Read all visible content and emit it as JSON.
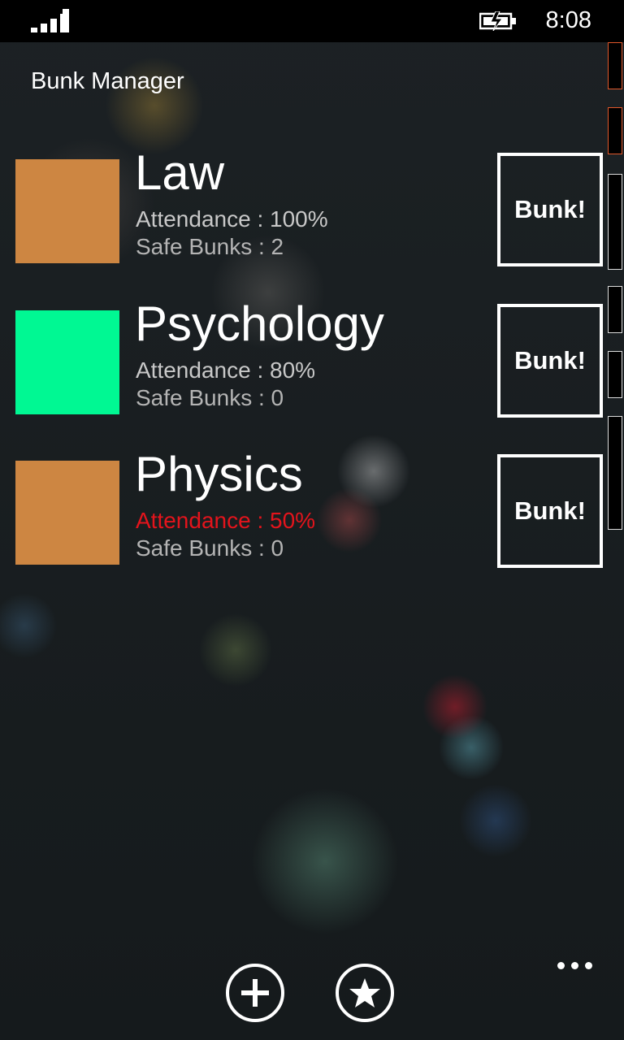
{
  "status_bar": {
    "time": "8:08",
    "signal_icon": "signal-strength-icon",
    "battery_icon": "battery-charging-icon"
  },
  "app": {
    "title": "Bunk Manager"
  },
  "subjects": [
    {
      "name": "Law",
      "color": "#cd8642",
      "attendance": "Attendance : 100%",
      "safe_bunks": "Safe Bunks : 2",
      "attendance_low": false,
      "button_label": "Bunk!"
    },
    {
      "name": "Psychology",
      "color": "#00f893",
      "attendance": "Attendance : 80%",
      "safe_bunks": "Safe Bunks : 0",
      "attendance_low": false,
      "button_label": "Bunk!"
    },
    {
      "name": "Physics",
      "color": "#cd8642",
      "attendance": "Attendance : 50%",
      "safe_bunks": "Safe Bunks : 0",
      "attendance_low": true,
      "button_label": "Bunk!"
    }
  ],
  "app_bar": {
    "add_icon": "plus-icon",
    "favorite_icon": "star-icon",
    "more_icon": "ellipsis-icon"
  },
  "colors": {
    "low_attendance": "#e3141c",
    "background": "#15191c"
  }
}
